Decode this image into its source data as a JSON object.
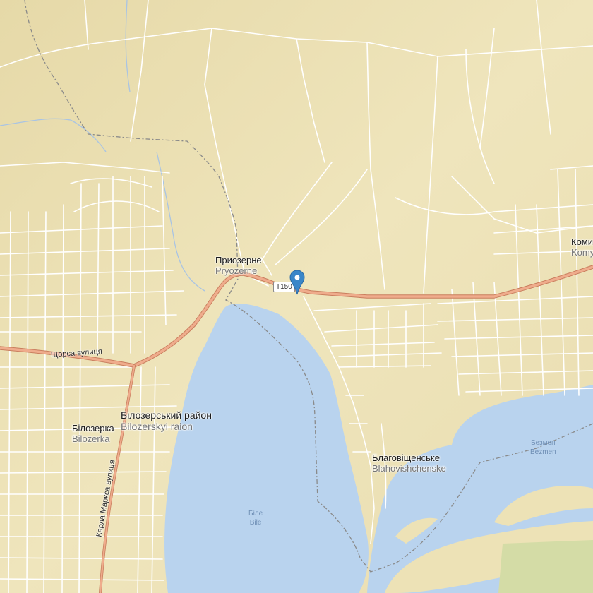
{
  "map": {
    "marker": {
      "icon": "map-pin-icon",
      "color": "#3a86c8"
    },
    "road_shield": "T150",
    "colors": {
      "land": "#ede2b6",
      "water": "#b9d3ee",
      "road_main": "#e8a584",
      "road_minor": "#ffffff",
      "boundary": "#8a8a8a",
      "field": "#d4dca6"
    },
    "places": {
      "pryozerne": {
        "native": "Приозерне",
        "latin": "Pryozerne"
      },
      "komyshany": {
        "native": "Коми",
        "latin": "Komy"
      },
      "raion": {
        "native": "Білозерський район",
        "latin": "Bilozerskyi raion"
      },
      "bilozerka": {
        "native": "Білозерка",
        "latin": "Bilozerka"
      },
      "blahovishchenske": {
        "native": "Благовіщенське",
        "latin": "Blahovishchenske"
      }
    },
    "water": {
      "bile": {
        "native": "Біле",
        "latin": "Bile"
      },
      "bezmen": {
        "native": "Безмен",
        "latin": "Bezmen"
      }
    },
    "streets": {
      "shchorsa": "Щорса вулиця",
      "karla_marksa": "Карла Маркса вулиця"
    }
  }
}
